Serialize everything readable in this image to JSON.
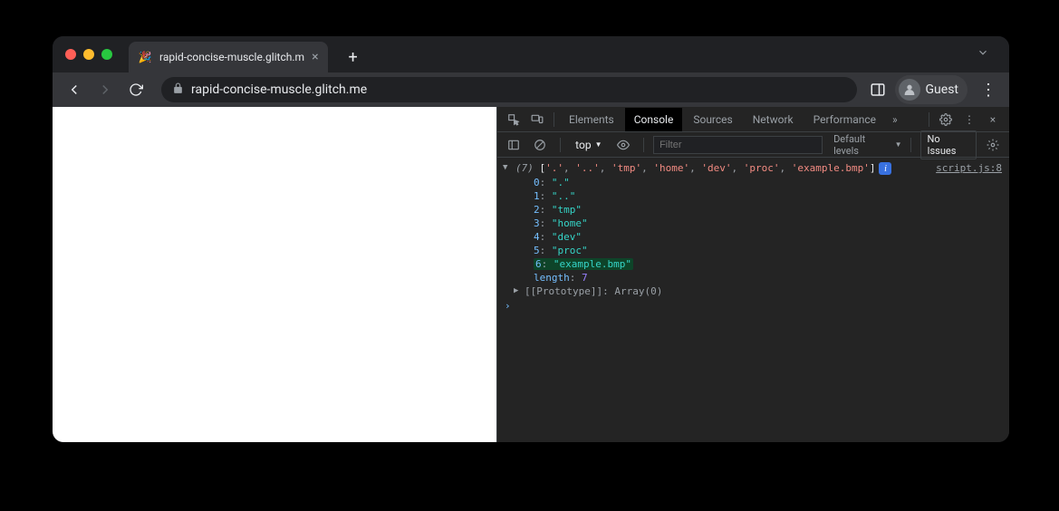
{
  "window": {
    "tab_title": "rapid-concise-muscle.glitch.m",
    "url": "rapid-concise-muscle.glitch.me",
    "profile_label": "Guest"
  },
  "devtools": {
    "tabs": {
      "elements": "Elements",
      "console": "Console",
      "sources": "Sources",
      "network": "Network",
      "performance": "Performance"
    },
    "subbar": {
      "context": "top",
      "filter_placeholder": "Filter",
      "levels": "Default levels",
      "issues": "No Issues"
    },
    "console": {
      "summary_count": "(7)",
      "summary_items": [
        "'.'",
        "'..'",
        "'tmp'",
        "'home'",
        "'dev'",
        "'proc'",
        "'example.bmp'"
      ],
      "source_link": "script.js:8",
      "entries": [
        {
          "key": "0",
          "value": "\".\""
        },
        {
          "key": "1",
          "value": "\"..\""
        },
        {
          "key": "2",
          "value": "\"tmp\""
        },
        {
          "key": "3",
          "value": "\"home\""
        },
        {
          "key": "4",
          "value": "\"dev\""
        },
        {
          "key": "5",
          "value": "\"proc\""
        },
        {
          "key": "6",
          "value": "\"example.bmp\"",
          "highlighted": true
        }
      ],
      "length_key": "length",
      "length_val": "7",
      "prototype_label": "[[Prototype]]",
      "prototype_value": "Array(0)"
    }
  }
}
